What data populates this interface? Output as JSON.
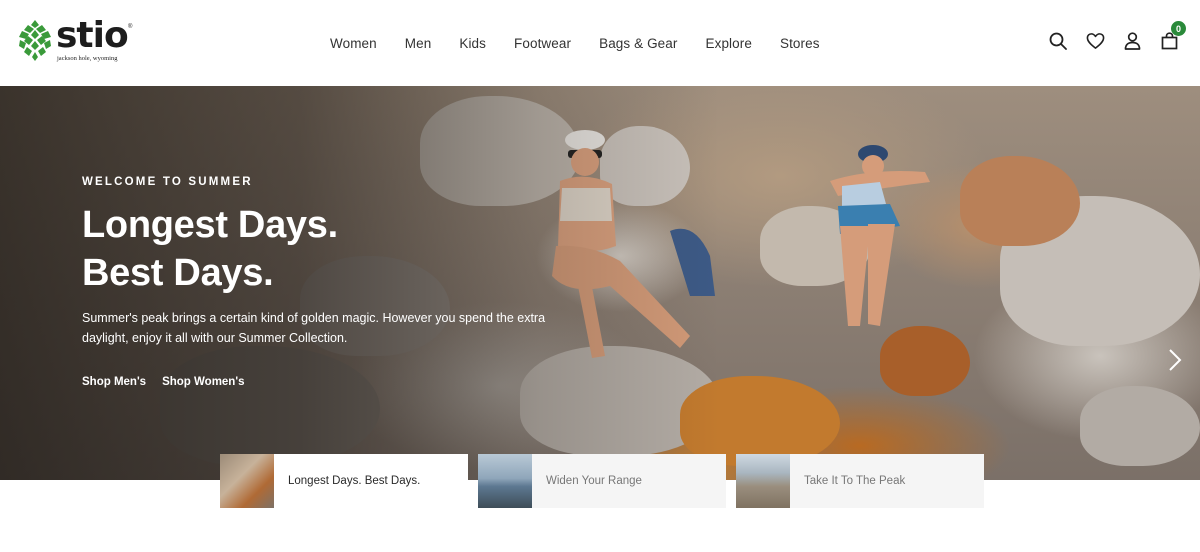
{
  "brand": {
    "name": "stio",
    "tagline": "jackson hole, wyoming",
    "registered": "®",
    "color": "#3a9a3a"
  },
  "nav": {
    "items": [
      {
        "label": "Women"
      },
      {
        "label": "Men"
      },
      {
        "label": "Kids"
      },
      {
        "label": "Footwear"
      },
      {
        "label": "Bags & Gear"
      },
      {
        "label": "Explore"
      },
      {
        "label": "Stores"
      }
    ]
  },
  "header_icons": {
    "search": "search-icon",
    "wishlist": "heart-icon",
    "account": "user-icon",
    "cart": "shopping-bag-icon",
    "cart_count": "0",
    "badge_color": "#2a8a3a"
  },
  "hero": {
    "eyebrow": "WELCOME TO SUMMER",
    "headline_line1": "Longest Days.",
    "headline_line2": "Best Days.",
    "subcopy": "Summer's peak brings a certain kind of golden magic. However you spend the extra daylight, enjoy it all with our Summer Collection.",
    "ctas": [
      {
        "label": "Shop Men's"
      },
      {
        "label": "Shop Women's"
      }
    ],
    "next_icon": "chevron-right-icon"
  },
  "slides": [
    {
      "label": "Longest Days. Best Days.",
      "active": true
    },
    {
      "label": "Widen Your Range",
      "active": false
    },
    {
      "label": "Take It To The Peak",
      "active": false
    }
  ]
}
